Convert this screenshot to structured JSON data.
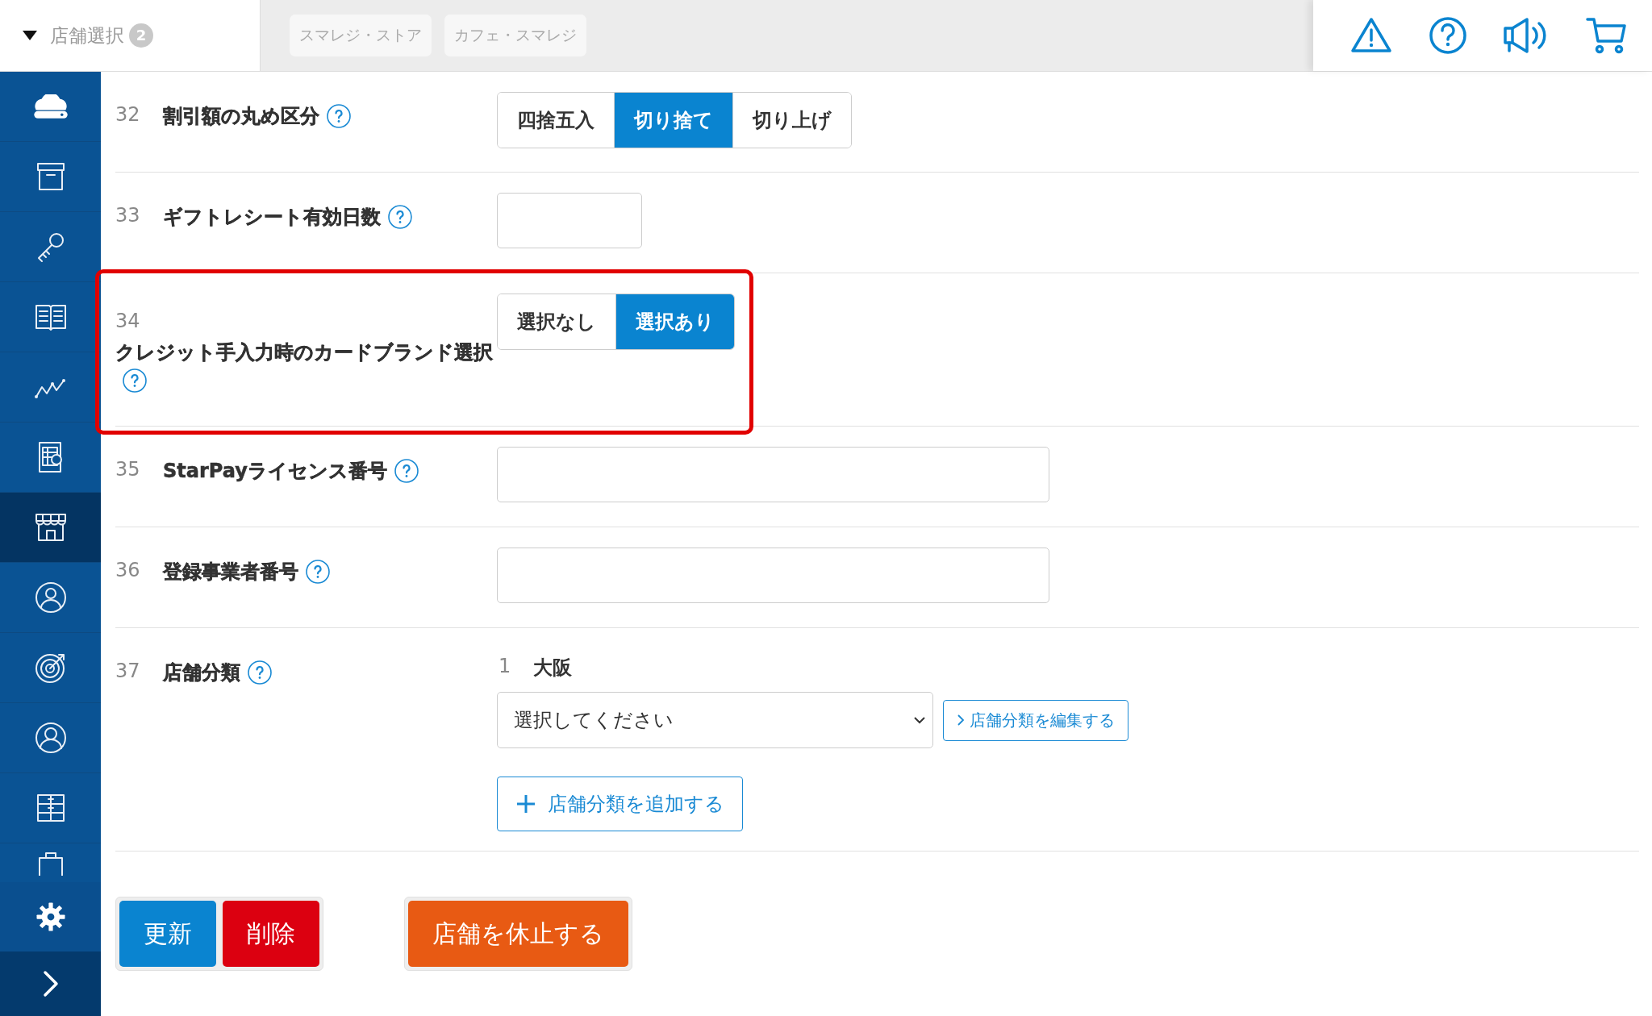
{
  "store_selector": {
    "label": "店舗選択",
    "count": "2",
    "expanded": true
  },
  "selected_stores": [
    "スマレジ・ストア",
    "カフェ・スマレジ"
  ],
  "sidebar": {
    "items": [
      {
        "selected": false
      },
      {
        "selected": false
      },
      {
        "selected": false
      },
      {
        "selected": false
      },
      {
        "selected": false
      },
      {
        "selected": false
      },
      {
        "selected": true
      },
      {
        "selected": false
      },
      {
        "selected": false
      },
      {
        "selected": false
      },
      {
        "selected": false
      },
      {
        "selected": false
      }
    ]
  },
  "rows": [
    {
      "number": "32",
      "label": "割引額の丸め区分",
      "kind": "segmented",
      "options": [
        {
          "label": "四捨五入",
          "selected": false
        },
        {
          "label": "切り捨て",
          "selected": true
        },
        {
          "label": "切り上げ",
          "selected": false
        }
      ]
    },
    {
      "number": "33",
      "label": "ギフトレシート有効日数",
      "kind": "short_input"
    },
    {
      "number": "34",
      "label": "クレジット手入力時のカードブランド選択",
      "kind": "segmented",
      "stacked": true,
      "highlighted": true,
      "options": [
        {
          "label": "選択なし",
          "selected": false
        },
        {
          "label": "選択あり",
          "selected": true
        }
      ]
    },
    {
      "number": "35",
      "label": "StarPayライセンス番号",
      "kind": "long_input"
    },
    {
      "number": "36",
      "label": "登録事業者番号",
      "kind": "long_input"
    },
    {
      "number": "37",
      "label": "店舗分類",
      "kind": "category",
      "entry_number": "1",
      "entry_name": "大阪",
      "select_placeholder": "選択してください",
      "edit_link": "店舗分類を編集する",
      "add_button": "店舗分類を追加する"
    }
  ],
  "actions": {
    "update": "更新",
    "delete": "削除",
    "suspend": "店舗を休止する"
  }
}
